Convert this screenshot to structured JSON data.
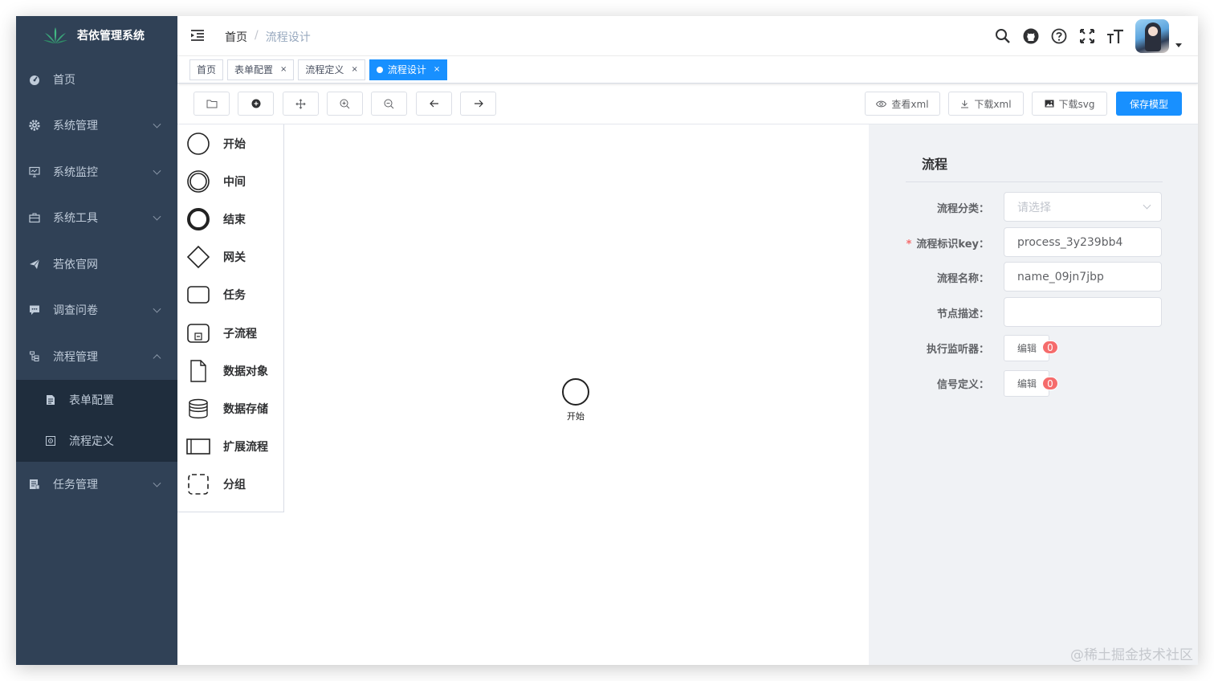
{
  "app": {
    "title": "若依管理系统"
  },
  "sidebar": {
    "items": [
      {
        "label": "首页",
        "icon": "dashboard-icon"
      },
      {
        "label": "系统管理",
        "icon": "gear-icon"
      },
      {
        "label": "系统监控",
        "icon": "monitor-icon"
      },
      {
        "label": "系统工具",
        "icon": "toolbox-icon"
      },
      {
        "label": "若依官网",
        "icon": "send-icon"
      },
      {
        "label": "调查问卷",
        "icon": "chat-icon"
      },
      {
        "label": "流程管理",
        "icon": "flow-icon"
      },
      {
        "label": "任务管理",
        "icon": "task-icon"
      }
    ],
    "flow_sub": [
      {
        "label": "表单配置",
        "icon": "form-icon"
      },
      {
        "label": "流程定义",
        "icon": "definition-icon"
      }
    ]
  },
  "breadcrumb": {
    "home": "首页",
    "sep": "/",
    "current": "流程设计"
  },
  "tags": [
    {
      "label": "首页"
    },
    {
      "label": "表单配置",
      "close": "×"
    },
    {
      "label": "流程定义",
      "close": "×"
    },
    {
      "label": "流程设计",
      "close": "×"
    }
  ],
  "toolbar": {
    "view_xml": "查看xml",
    "download_xml": "下载xml",
    "download_svg": "下载svg",
    "save": "保存模型"
  },
  "palette": [
    {
      "label": "开始"
    },
    {
      "label": "中间"
    },
    {
      "label": "结束"
    },
    {
      "label": "网关"
    },
    {
      "label": "任务"
    },
    {
      "label": "子流程"
    },
    {
      "label": "数据对象"
    },
    {
      "label": "数据存储"
    },
    {
      "label": "扩展流程"
    },
    {
      "label": "分组"
    }
  ],
  "canvas": {
    "start_label": "开始"
  },
  "props": {
    "title": "流程",
    "category_label": "流程分类：",
    "category_placeholder": "请选择",
    "key_required": "*",
    "key_label": "流程标识key：",
    "key_value": "process_3y239bb4",
    "name_label": "流程名称：",
    "name_value": "name_09jn7jbp",
    "desc_label": "节点描述：",
    "desc_value": "",
    "listener_label": "执行监听器：",
    "listener_btn": "编辑",
    "listener_count": "0",
    "signal_label": "信号定义：",
    "signal_btn": "编辑",
    "signal_count": "0"
  },
  "watermark": "@稀土掘金技术社区",
  "colors": {
    "sidebar": "#304156",
    "submenu": "#1f2d3d",
    "primary": "#1890ff",
    "badge": "#f56c6c"
  }
}
